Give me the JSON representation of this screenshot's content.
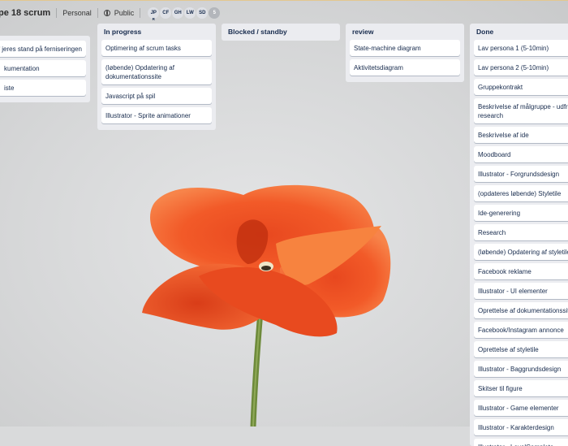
{
  "header": {
    "board_title": "pe 18 scrum",
    "team_label": "Personal",
    "visibility_label": "Public",
    "members": [
      {
        "initials": "JP",
        "sub": "R"
      },
      {
        "initials": "CF",
        "sub": ""
      },
      {
        "initials": "GH",
        "sub": ""
      },
      {
        "initials": "LW",
        "sub": ""
      },
      {
        "initials": "SD",
        "sub": ""
      }
    ],
    "more_members": "5"
  },
  "lists": [
    {
      "title": "",
      "cards": [
        "af jeres stand på ferniseringen",
        "kumentation",
        "iste"
      ]
    },
    {
      "title": "In progress",
      "cards": [
        "Optimering af scrum tasks",
        "(løbende) Opdatering af dokumentationssite",
        "Javascript på spil",
        "Illustrator - Sprite animationer"
      ]
    },
    {
      "title": "Blocked / standby",
      "cards": []
    },
    {
      "title": "review",
      "cards": [
        "State-machine diagram",
        "Aktivitetsdiagram"
      ]
    },
    {
      "title": "Done",
      "cards": [
        "Lav persona 1 (5-10min)",
        "Lav persona 2 (5-10min)",
        "Gruppekontrakt",
        "Beskrivelse af målgruppe - udfra research",
        "Beskrivelse af ide",
        "Moodboard",
        "Illustrator - Forgrundsdesign",
        "(opdateres løbende) Styletile",
        "Ide-generering",
        "Research",
        "(løbende) Opdatering af styletile",
        "Facebook reklame",
        "Illustrator - UI elementer",
        "Oprettelse af dokumentationssite",
        "Facebook/Instagram annonce",
        "Oprettelse af styletile",
        "Illustrator - Baggrundsdesign",
        "Skitser til figure",
        "Illustrator - Game elementer",
        "Illustrator - Karakterdesign",
        "Illustrator - LevelComplete skærm GameOver"
      ]
    }
  ]
}
